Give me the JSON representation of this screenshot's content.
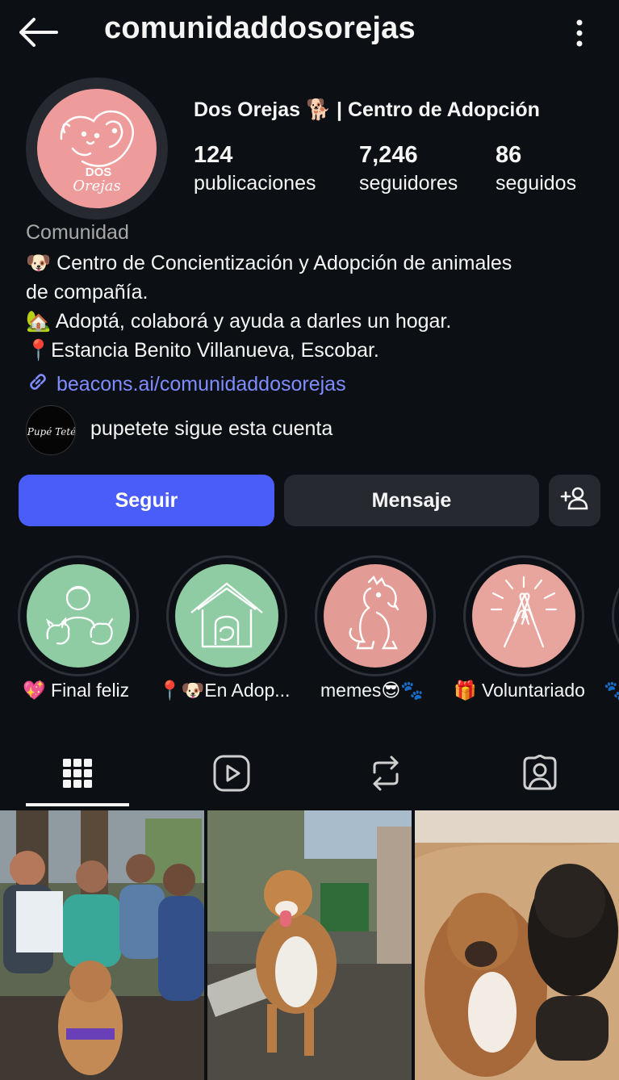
{
  "header": {
    "username": "comunidaddosorejas",
    "back_icon": "arrow-left-icon",
    "menu_icon": "more-vertical-icon"
  },
  "profile": {
    "avatar_logo_text": "DOS Orejas",
    "display_name": "Dos Orejas 🐕 | Centro de Adopción",
    "stats": [
      {
        "value": "124",
        "label": "publicaciones"
      },
      {
        "value": "7,246",
        "label": "seguidores"
      },
      {
        "value": "86",
        "label": "seguidos"
      }
    ],
    "category": "Comunidad",
    "bio": [
      "🐶 Centro de Concientización y Adopción de animales",
      "de compañía.",
      "🏡 Adoptá, colaborá y ayuda a darles un hogar.",
      "📍Estancia Benito Villanueva, Escobar."
    ],
    "link": "beacons.ai/comunidaddosorejas",
    "followed_by": {
      "avatar_text": "Pupé Teté",
      "text": "pupetete sigue esta cuenta"
    }
  },
  "actions": {
    "follow_label": "Seguir",
    "message_label": "Mensaje",
    "add_user_icon": "add-user-icon"
  },
  "highlights": [
    {
      "label": "💖 Final feliz",
      "color": "#8fcca3"
    },
    {
      "label": "📍🐶En Adop...",
      "color": "#8fcca3"
    },
    {
      "label": "memes😎🐾",
      "color": "#e39b95"
    },
    {
      "label": "🎁 Voluntariado",
      "color": "#e8a59d"
    }
  ],
  "tabs": [
    {
      "icon": "grid-icon",
      "active": true
    },
    {
      "icon": "reels-icon",
      "active": false
    },
    {
      "icon": "repost-icon",
      "active": false
    },
    {
      "icon": "tagged-icon",
      "active": false
    }
  ],
  "colors": {
    "background": "#0c1014",
    "accent": "#4a5df9",
    "link": "#7e8cff",
    "button_secondary": "#262a30"
  }
}
